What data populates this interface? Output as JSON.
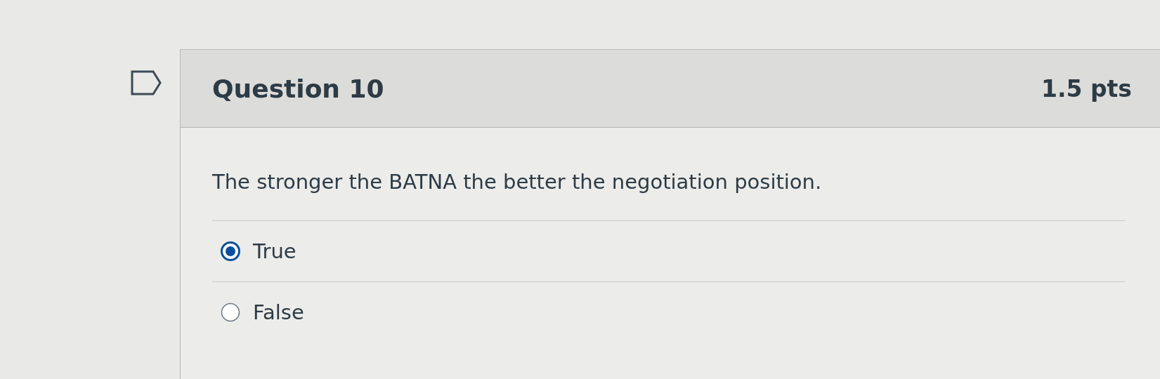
{
  "question": {
    "title": "Question 10",
    "points": "1.5 pts",
    "text": "The stronger the BATNA the better the negotiation position.",
    "answers": [
      {
        "label": "True",
        "selected": true
      },
      {
        "label": "False",
        "selected": false
      }
    ]
  }
}
